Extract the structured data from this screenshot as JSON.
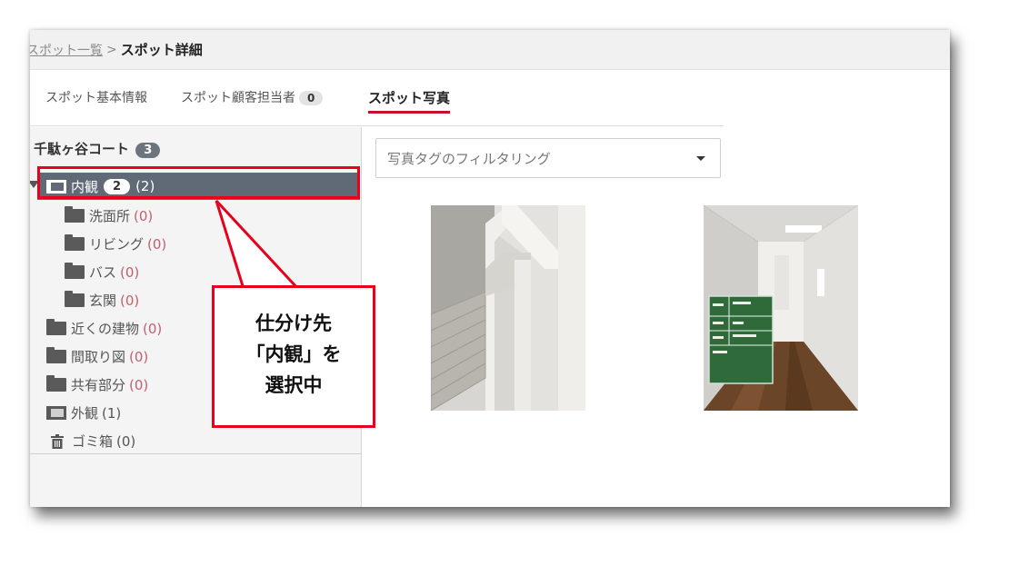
{
  "breadcrumb": {
    "link": "スポット一覧",
    "separator": ">",
    "current": "スポット詳細"
  },
  "tabs": [
    {
      "label": "スポット基本情報"
    },
    {
      "label": "スポット顧客担当者",
      "count": "0"
    },
    {
      "label": "スポット写真",
      "active": true
    }
  ],
  "tree": {
    "root_label": "千駄ヶ谷コート",
    "root_count": "3",
    "selected": {
      "label": "内観",
      "badge": "2",
      "count": "(2)"
    },
    "children": [
      {
        "label": "洗面所",
        "count": "(0)"
      },
      {
        "label": "リビング",
        "count": "(0)"
      },
      {
        "label": "バス",
        "count": "(0)"
      },
      {
        "label": "玄関",
        "count": "(0)"
      }
    ],
    "folders": [
      {
        "label": "近くの建物",
        "count": "(0)"
      },
      {
        "label": "間取り図",
        "count": "(0)"
      },
      {
        "label": "共有部分",
        "count": "(0)"
      }
    ],
    "exterior": {
      "label": "外観",
      "count": "(1)"
    },
    "trash": {
      "label": "ゴミ箱",
      "count": "(0)"
    }
  },
  "filter": {
    "placeholder": "写真タグのフィルタリング"
  },
  "callout": {
    "text": "仕分け先\n「内観」を\n選択中"
  },
  "colors": {
    "accent": "#c8102e",
    "callout_red": "#e8001c",
    "selected_bg": "#5f6a76"
  },
  "photos": [
    {
      "name": "staircase-photo"
    },
    {
      "name": "hallway-photo"
    }
  ]
}
